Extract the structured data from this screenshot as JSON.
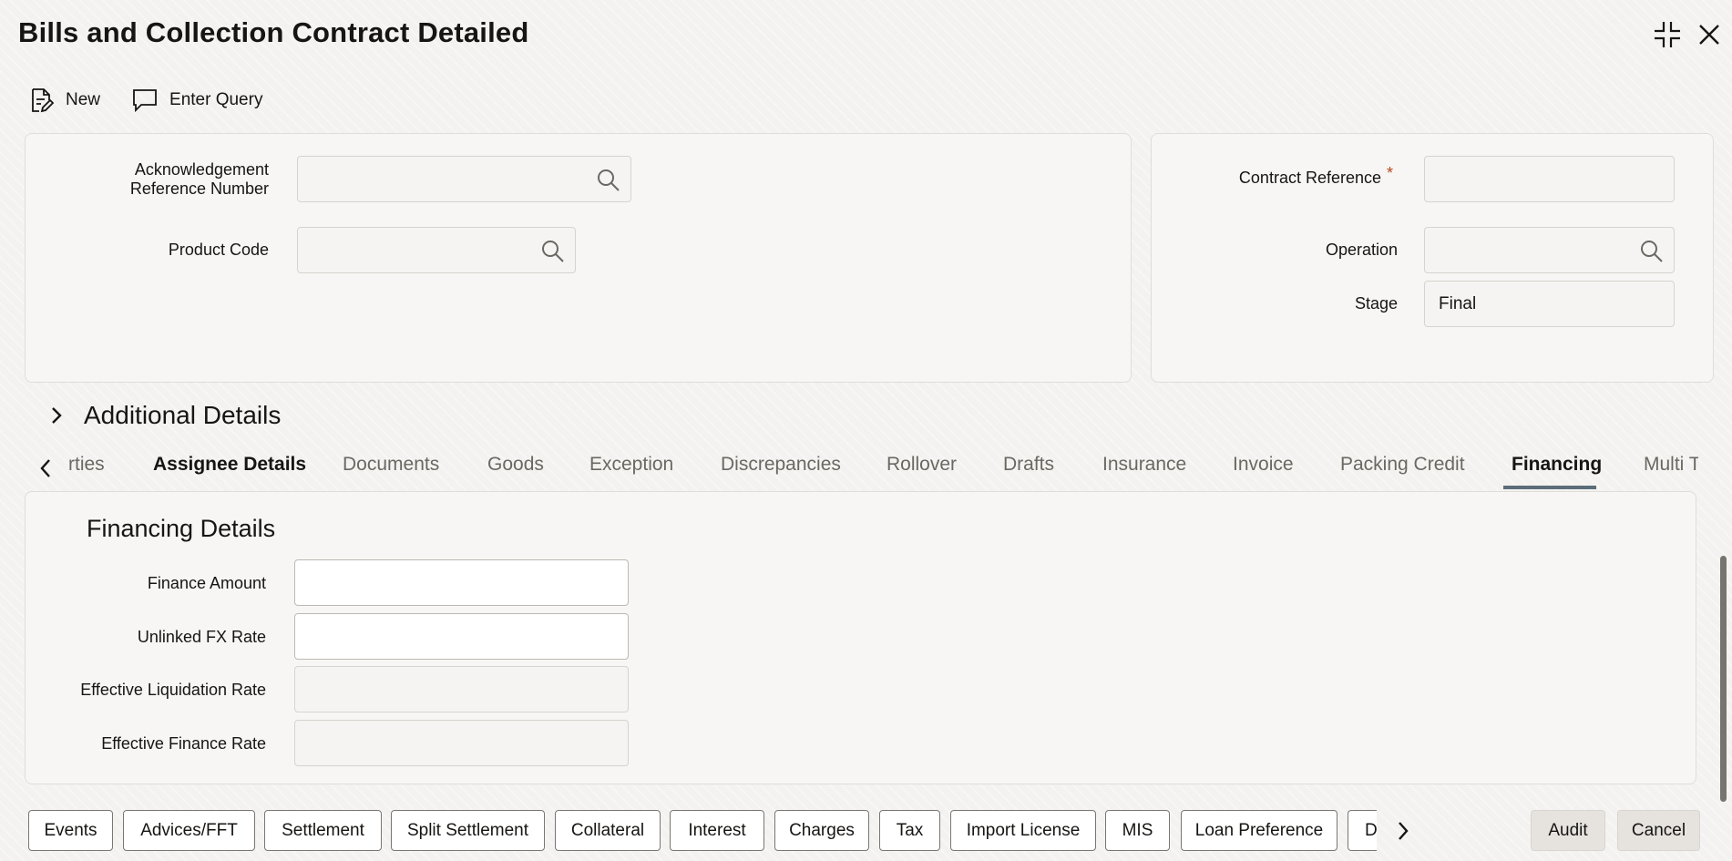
{
  "window": {
    "title": "Bills and Collection Contract Detailed"
  },
  "toolbar": {
    "new_label": "New",
    "enter_query_label": "Enter Query"
  },
  "main_panel": {
    "ack_ref_label_line1": "Acknowledgement",
    "ack_ref_label_line2": "Reference Number",
    "ack_ref_value": "",
    "product_code_label": "Product Code",
    "product_code_value": ""
  },
  "side_panel": {
    "contract_reference_label": "Contract Reference",
    "required_mark": "*",
    "contract_reference_value": "",
    "operation_label": "Operation",
    "operation_value": "",
    "stage_label": "Stage",
    "stage_value": "Final"
  },
  "additional_details": {
    "label": "Additional Details"
  },
  "tabs": {
    "items": [
      {
        "label": "rties"
      },
      {
        "label": "Assignee Details"
      },
      {
        "label": "Documents"
      },
      {
        "label": "Goods"
      },
      {
        "label": "Exception"
      },
      {
        "label": "Discrepancies"
      },
      {
        "label": "Rollover"
      },
      {
        "label": "Drafts"
      },
      {
        "label": "Insurance"
      },
      {
        "label": "Invoice"
      },
      {
        "label": "Packing Credit"
      },
      {
        "label": "Financing"
      },
      {
        "label": "Multi T"
      }
    ],
    "active": "Financing"
  },
  "financing": {
    "section_title": "Financing Details",
    "finance_amount_label": "Finance Amount",
    "finance_amount_value": "",
    "unlinked_fx_label": "Unlinked FX Rate",
    "unlinked_fx_value": "",
    "eff_liq_label": "Effective Liquidation Rate",
    "eff_liq_value": "",
    "eff_fin_label": "Effective Finance Rate",
    "eff_fin_value": ""
  },
  "footer": {
    "buttons": [
      {
        "label": "Events"
      },
      {
        "label": "Advices/FFT"
      },
      {
        "label": "Settlement"
      },
      {
        "label": "Split Settlement"
      },
      {
        "label": "Collateral"
      },
      {
        "label": "Interest"
      },
      {
        "label": "Charges"
      },
      {
        "label": "Tax"
      },
      {
        "label": "Import License"
      },
      {
        "label": "MIS"
      },
      {
        "label": "Loan Preference"
      },
      {
        "label": "D"
      }
    ],
    "audit_label": "Audit",
    "cancel_label": "Cancel"
  }
}
